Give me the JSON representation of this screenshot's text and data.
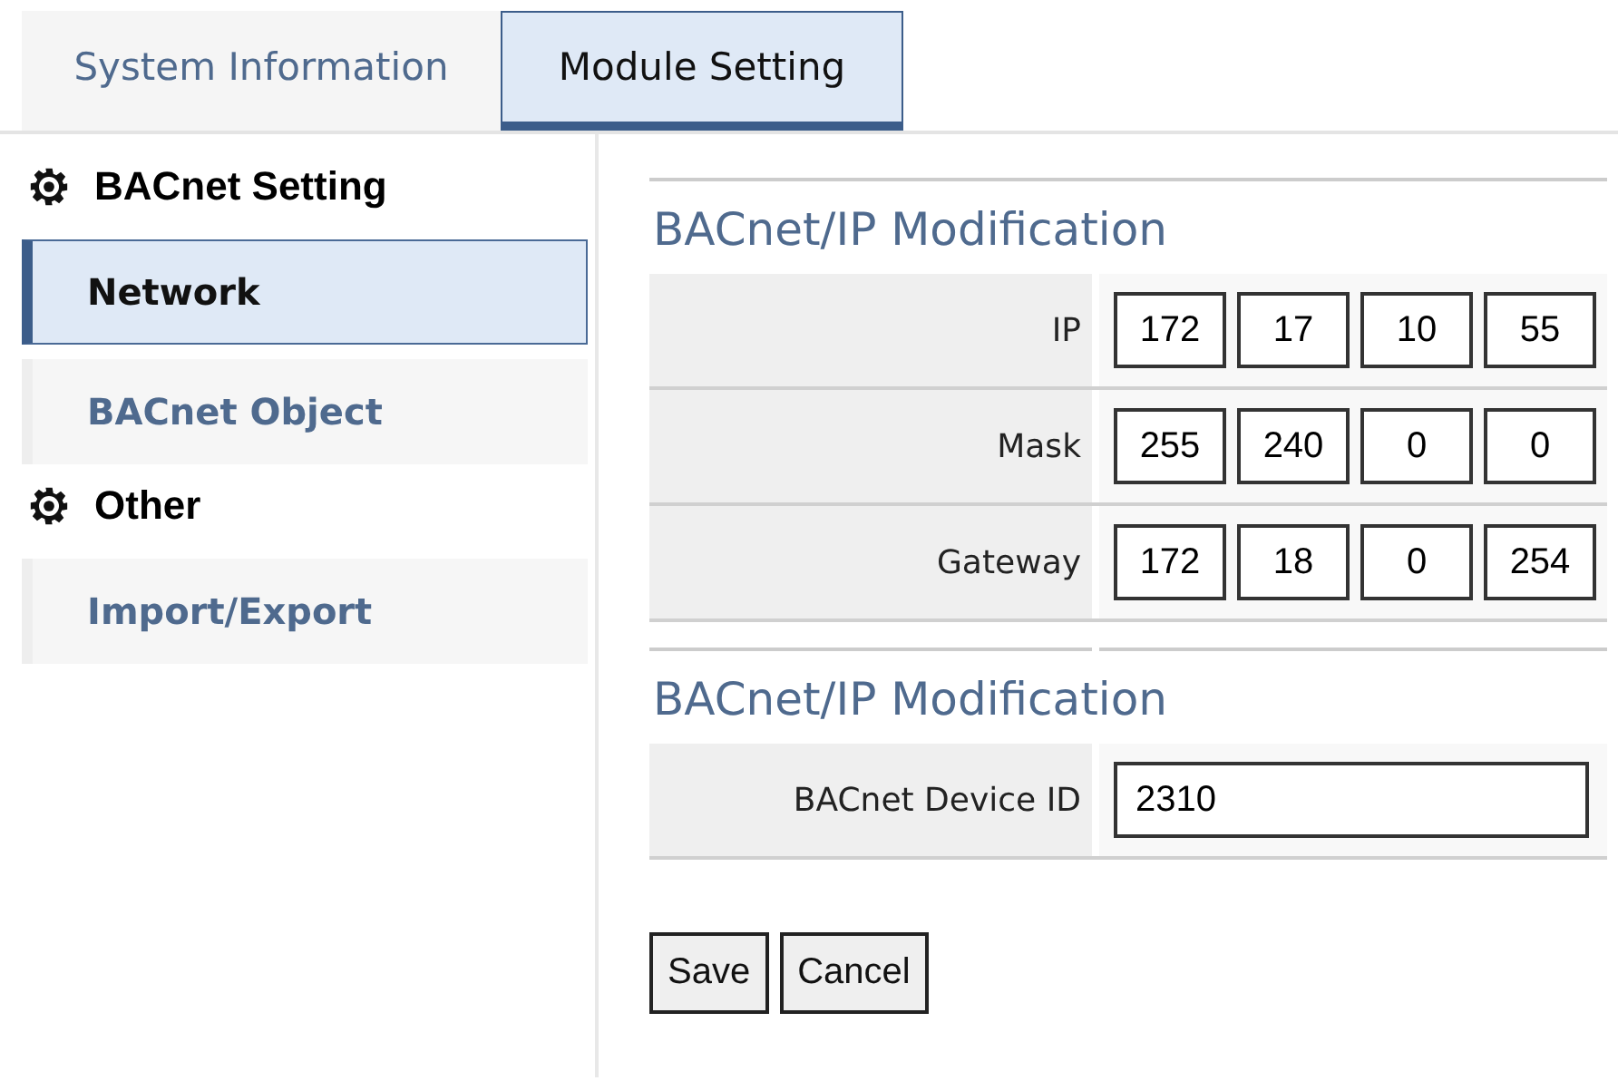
{
  "tabs": [
    {
      "label": "System Information",
      "selected": false
    },
    {
      "label": "Module Setting",
      "selected": true
    }
  ],
  "sidebar": {
    "groups": [
      {
        "title": "BACnet Setting",
        "items": [
          {
            "label": "Network",
            "selected": true
          },
          {
            "label": "BACnet Object",
            "selected": false
          }
        ]
      },
      {
        "title": "Other",
        "items": [
          {
            "label": "Import/Export",
            "selected": false
          }
        ]
      }
    ]
  },
  "sections": [
    {
      "heading": "BACnet/IP Modification",
      "rows": [
        {
          "label": "IP",
          "kind": "octets",
          "values": [
            "172",
            "17",
            "10",
            "55"
          ]
        },
        {
          "label": "Mask",
          "kind": "octets",
          "values": [
            "255",
            "240",
            "0",
            "0"
          ]
        },
        {
          "label": "Gateway",
          "kind": "octets",
          "values": [
            "172",
            "18",
            "0",
            "254"
          ]
        }
      ]
    },
    {
      "heading": "BACnet/IP Modification",
      "rows": [
        {
          "label": "BACnet Device ID",
          "kind": "text",
          "value": "2310"
        }
      ]
    }
  ],
  "buttons": [
    "Save",
    "Cancel"
  ]
}
